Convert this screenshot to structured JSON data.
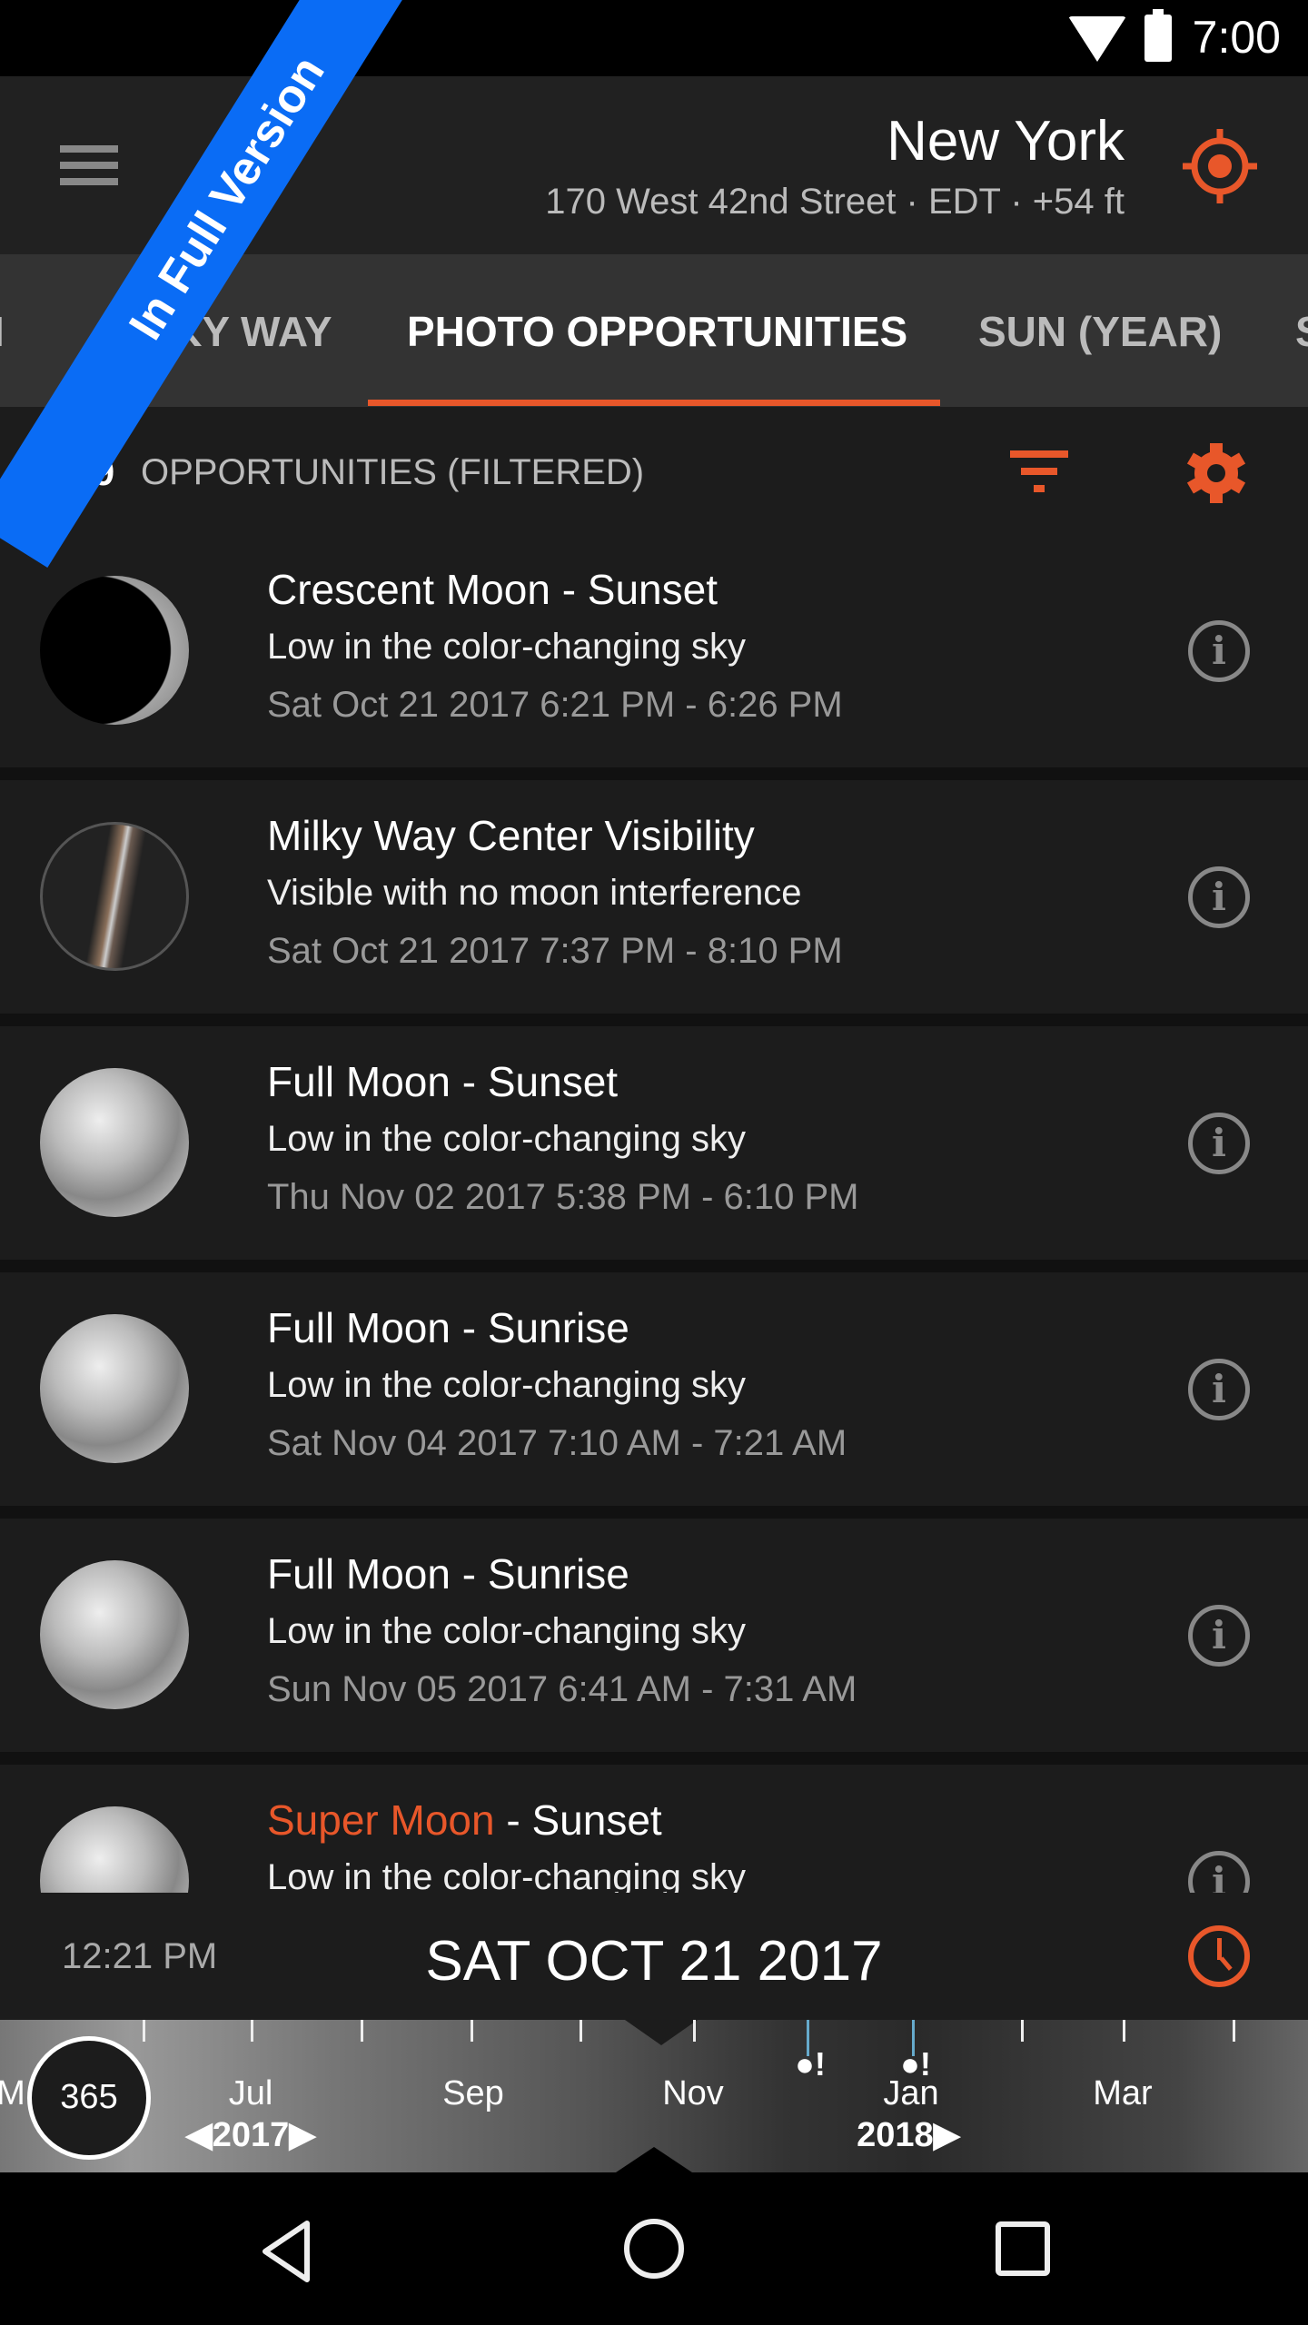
{
  "status_bar": {
    "time": "7:00"
  },
  "banner": "In Full Version",
  "toolbar": {
    "city": "New York",
    "address": "170 West 42nd Street  ·  EDT  ·  +54 ft"
  },
  "tabs": [
    {
      "label": "I"
    },
    {
      "label": "MILKY WAY"
    },
    {
      "label": "PHOTO OPPORTUNITIES",
      "active": true
    },
    {
      "label": "SUN (YEAR)"
    },
    {
      "label": "S"
    }
  ],
  "summary": {
    "count": "289",
    "label": "OPPORTUNITIES (FILTERED)"
  },
  "accent": "#e8572a",
  "opportunities": [
    {
      "icon": "crescent-moon",
      "title": "Crescent Moon - Sunset",
      "subtitle": "Low in the color-changing sky",
      "date": "Sat Oct 21 2017 6:21 PM - 6:26 PM"
    },
    {
      "icon": "milky-way",
      "title": "Milky Way Center Visibility",
      "subtitle": "Visible with no moon interference",
      "date": "Sat Oct 21 2017 7:37 PM - 8:10 PM"
    },
    {
      "icon": "full-moon",
      "title": "Full Moon - Sunset",
      "subtitle": "Low in the color-changing sky",
      "date": "Thu Nov 02 2017 5:38 PM - 6:10 PM"
    },
    {
      "icon": "full-moon",
      "title": "Full Moon - Sunrise",
      "subtitle": "Low in the color-changing sky",
      "date": "Sat Nov 04 2017 7:10 AM - 7:21 AM"
    },
    {
      "icon": "full-moon",
      "title": "Full Moon - Sunrise",
      "subtitle": "Low in the color-changing sky",
      "date": "Sun Nov 05 2017 6:41 AM - 7:31 AM"
    },
    {
      "icon": "full-moon",
      "title_highlight": "Super Moon",
      "title": " - Sunset",
      "subtitle": "Low in the color-changing sky",
      "date": ""
    }
  ],
  "date_bar": {
    "time": "12:21 PM",
    "date": "SAT OCT 21 2017"
  },
  "timeline": {
    "days": "365",
    "months": [
      "M",
      "Jul",
      "Sep",
      "Nov",
      "Jan",
      "Mar"
    ],
    "years": [
      "2017",
      "2018"
    ],
    "marker": "!"
  }
}
